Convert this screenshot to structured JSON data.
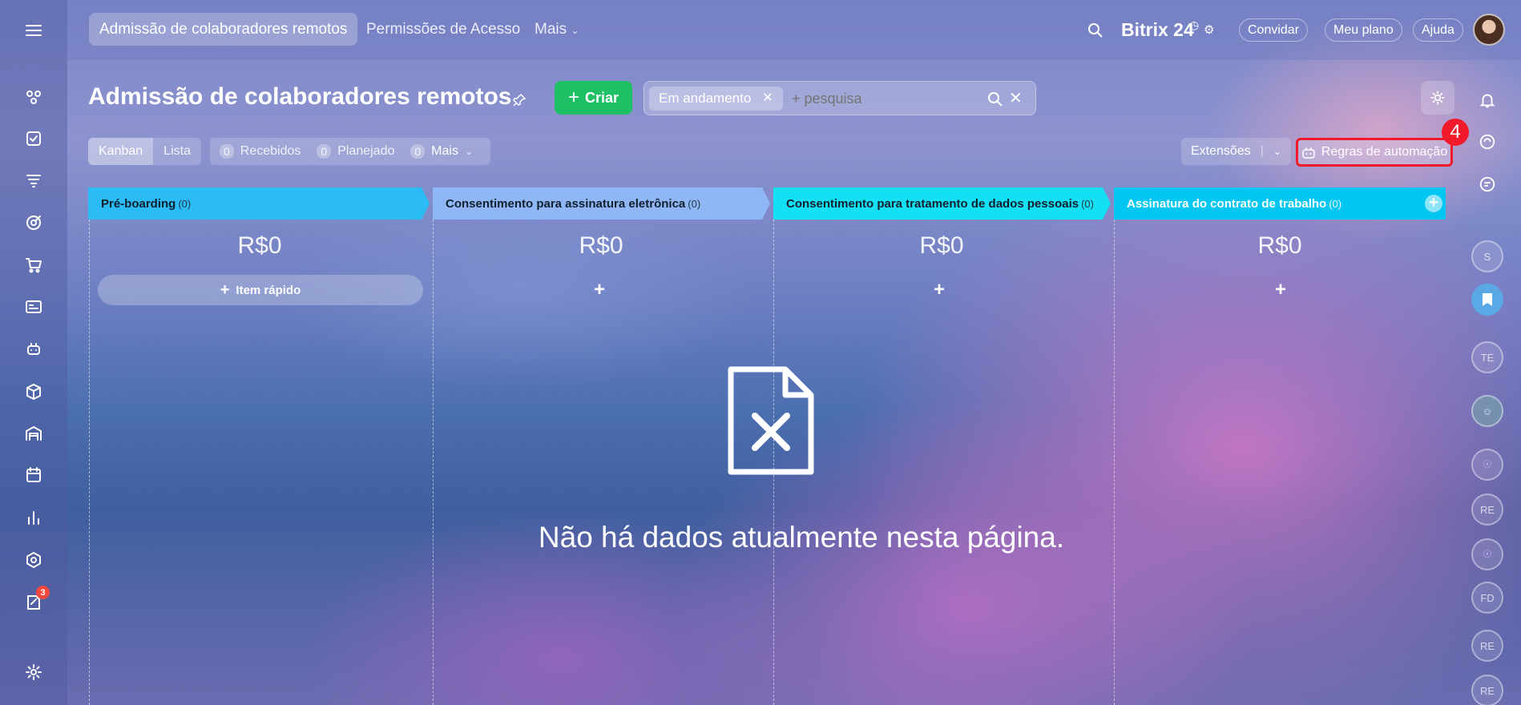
{
  "app": {
    "brand": "Bitrix 24",
    "brand_suffix": "",
    "top_tabs": [
      "Admissão de colaboradores remotos",
      "Permissões de Acesso",
      "Mais"
    ],
    "top_buttons": {
      "invite": "Convidar",
      "plan": "Meu plano",
      "help": "Ajuda"
    }
  },
  "sidebar": {
    "items": [
      "menu-icon",
      "sites-icon",
      "tasks-icon",
      "crm-funnel-icon",
      "target-icon",
      "cart-icon",
      "contact-card-icon",
      "robot-icon",
      "box-icon",
      "warehouse-icon",
      "calendar-icon",
      "chart-icon",
      "hexagon-icon",
      "edit-doc-icon",
      "gear-icon"
    ],
    "edit_doc_badge": "3"
  },
  "header": {
    "title": "Admissão de colaboradores remotos",
    "create_label": "Criar",
    "filter_chip": "Em andamento",
    "search_placeholder": "+ pesquisa"
  },
  "toolbar": {
    "view_kanban": "Kanban",
    "view_list": "Lista",
    "received_count": "0",
    "received_label": "Recebidos",
    "planned_count": "0",
    "planned_label": "Planejado",
    "more_count": "0",
    "more_label": "Mais",
    "extensions": "Extensões",
    "automation": "Regras de automação",
    "step_badge": "4"
  },
  "stages": [
    {
      "name": "Pré-boarding",
      "count": "(0)",
      "sum": "R$0",
      "color": "#2bbcf5"
    },
    {
      "name": "Consentimento para assinatura eletrônica",
      "count": "(0)",
      "sum": "R$0",
      "color": "#8fb6f5"
    },
    {
      "name": "Consentimento para tratamento de dados pessoais",
      "count": "(0)",
      "sum": "R$0",
      "color": "#14e0f4"
    },
    {
      "name": "Assinatura do contrato de trabalho",
      "count": "(0)",
      "sum": "R$0",
      "color": "#00c6f2"
    }
  ],
  "quick_item_label": "Item rápido",
  "empty_message": "Não há dados atualmente nesta página.",
  "right_rail": [
    "bell-icon",
    "copilot-icon",
    "chat-icon",
    "S",
    "bookmark-icon",
    "TE",
    "avatar-icon",
    "openlines-icon",
    "RE",
    "openlines-icon",
    "FD",
    "RE",
    "RE"
  ]
}
